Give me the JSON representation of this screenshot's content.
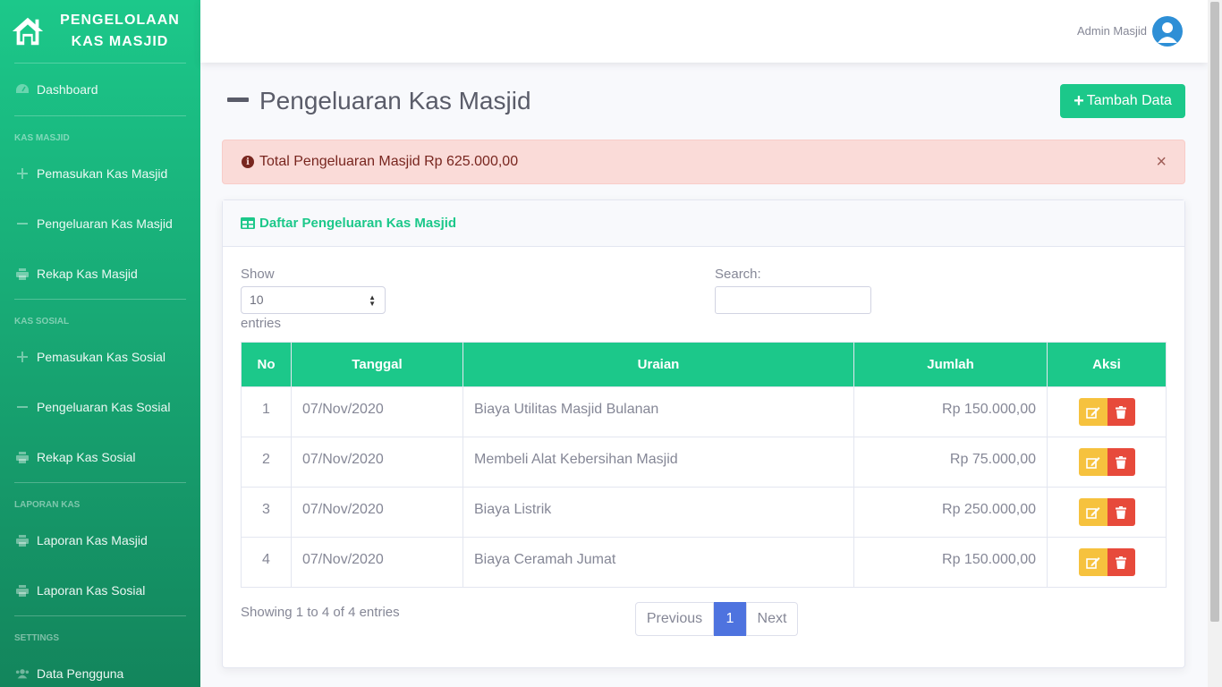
{
  "brand": {
    "title_line1": "PENGELOLAAN",
    "title_line2": "KAS MASJID"
  },
  "sidebar": {
    "dashboard": "Dashboard",
    "sections": [
      {
        "heading": "KAS MASJID",
        "items": [
          {
            "label": "Pemasukan Kas Masjid",
            "icon": "plus-icon"
          },
          {
            "label": "Pengeluaran Kas Masjid",
            "icon": "minus-icon"
          },
          {
            "label": "Rekap Kas Masjid",
            "icon": "print-icon"
          }
        ]
      },
      {
        "heading": "KAS SOSIAL",
        "items": [
          {
            "label": "Pemasukan Kas Sosial",
            "icon": "plus-icon"
          },
          {
            "label": "Pengeluaran Kas Sosial",
            "icon": "minus-icon"
          },
          {
            "label": "Rekap Kas Sosial",
            "icon": "print-icon"
          }
        ]
      },
      {
        "heading": "LAPORAN KAS",
        "items": [
          {
            "label": "Laporan Kas Masjid",
            "icon": "print-icon"
          },
          {
            "label": "Laporan Kas Sosial",
            "icon": "print-icon"
          }
        ]
      },
      {
        "heading": "SETTINGS",
        "items": [
          {
            "label": "Data Pengguna",
            "icon": "users-icon"
          }
        ]
      }
    ]
  },
  "topbar": {
    "user_name": "Admin Masjid"
  },
  "page": {
    "title": "Pengeluaran Kas Masjid",
    "add_button": "Tambah Data"
  },
  "alert": {
    "text": "Total Pengeluaran Masjid Rp 625.000,00",
    "close": "×"
  },
  "card": {
    "title": "Daftar Pengeluaran Kas Masjid"
  },
  "datatable": {
    "show_label": "Show",
    "entries_label": "entries",
    "length_value": "10",
    "search_label": "Search:",
    "search_value": "",
    "columns": [
      "No",
      "Tanggal",
      "Uraian",
      "Jumlah",
      "Aksi"
    ],
    "rows": [
      {
        "no": "1",
        "date": "07/Nov/2020",
        "desc": "Biaya Utilitas Masjid Bulanan",
        "amount": "Rp 150.000,00"
      },
      {
        "no": "2",
        "date": "07/Nov/2020",
        "desc": "Membeli Alat Kebersihan Masjid",
        "amount": "Rp 75.000,00"
      },
      {
        "no": "3",
        "date": "07/Nov/2020",
        "desc": "Biaya Listrik",
        "amount": "Rp 250.000,00"
      },
      {
        "no": "4",
        "date": "07/Nov/2020",
        "desc": "Biaya Ceramah Jumat",
        "amount": "Rp 150.000,00"
      }
    ],
    "info": "Showing 1 to 4 of 4 entries",
    "pagination": {
      "previous": "Previous",
      "current": "1",
      "next": "Next"
    }
  },
  "colors": {
    "primary": "#1cc88a",
    "danger": "#e74a3b",
    "warning": "#f6c23e",
    "page_active": "#4e73df"
  }
}
